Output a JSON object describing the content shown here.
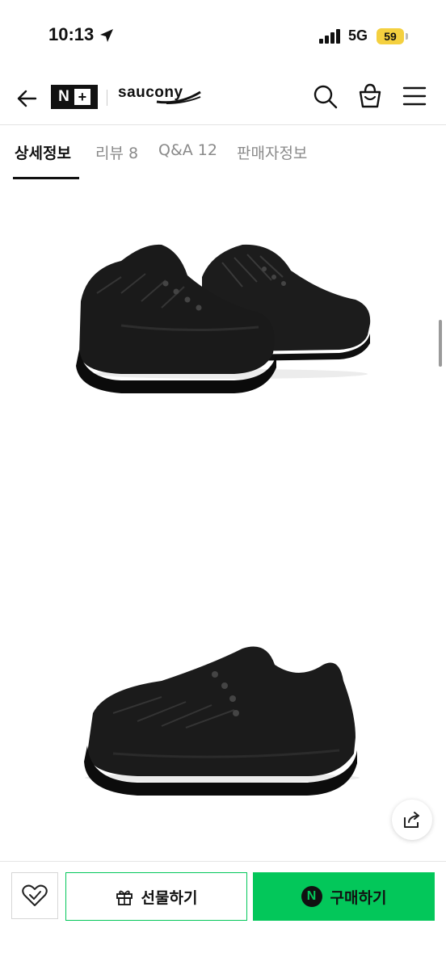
{
  "status_bar": {
    "time": "10:13",
    "network": "5G",
    "battery": "59",
    "icons": [
      "location-arrow-icon",
      "signal-bars-icon",
      "battery-icon"
    ]
  },
  "header": {
    "back_icon": "arrow-left-icon",
    "store_logo": {
      "n": "N",
      "plus": "+"
    },
    "brand": "saucony",
    "actions": [
      "search-icon",
      "shopping-bag-icon",
      "hamburger-menu-icon"
    ]
  },
  "tabs": [
    {
      "label": "상세정보",
      "active": true
    },
    {
      "label": "리뷰 8",
      "active": false
    },
    {
      "label": "Q&A 12",
      "active": false
    },
    {
      "label": "판매자정보",
      "active": false
    }
  ],
  "content": {
    "images": [
      "shoe-pair-image",
      "single-shoe-image"
    ],
    "share_icon": "share-icon"
  },
  "bottom_bar": {
    "wish_icon": "heart-check-icon",
    "gift_label": "선물하기",
    "buy_label": "구매하기",
    "npay_mark": "N"
  },
  "colors": {
    "accent_green": "#03c75a",
    "battery_yellow": "#f4d03f",
    "text_dark": "#111111",
    "tab_inactive": "#8a8a8a"
  }
}
